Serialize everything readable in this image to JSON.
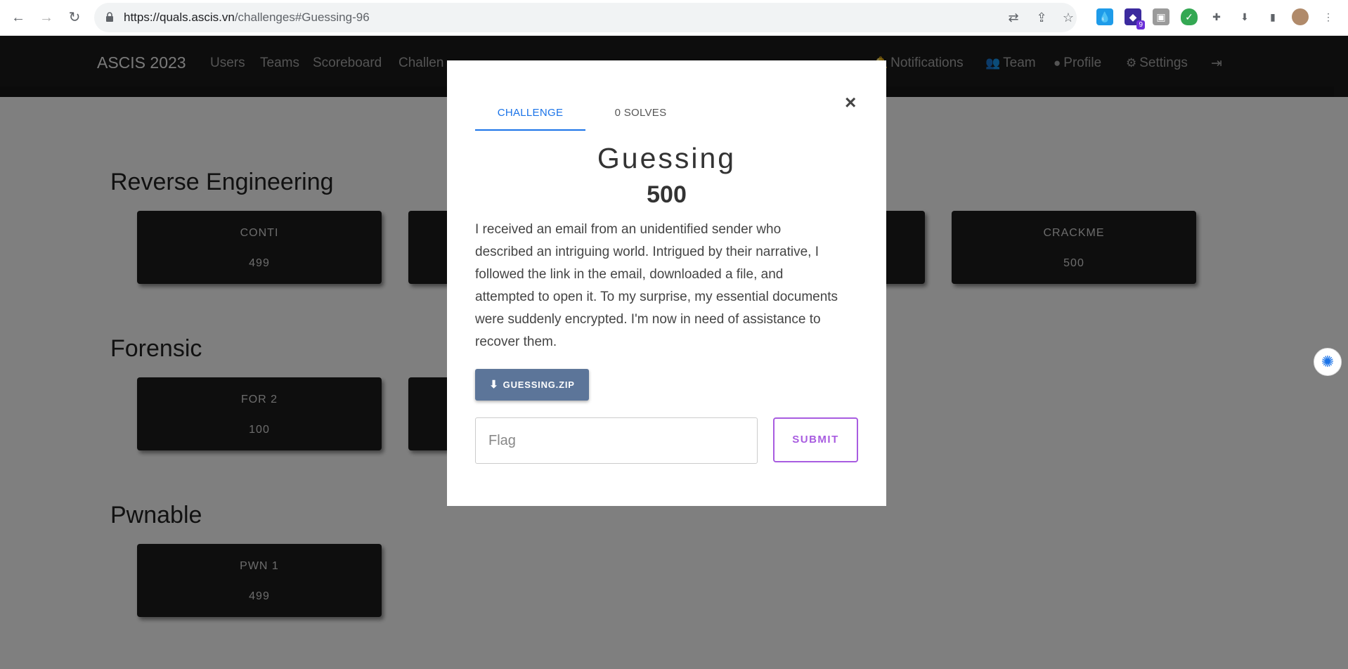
{
  "browser": {
    "url_host": "https://quals.ascis.vn",
    "url_path": "/challenges#Guessing-96",
    "extension_badge": "9"
  },
  "site": {
    "brand": "ASCIS 2023",
    "nav_left": [
      "Users",
      "Teams",
      "Scoreboard",
      "Challen"
    ],
    "nav_right": {
      "notifications": "Notifications",
      "team": "Team",
      "profile": "Profile",
      "settings": "Settings"
    }
  },
  "categories": [
    {
      "title": "Reverse Engineering",
      "cards": [
        {
          "name": "CONTI",
          "value": "499"
        },
        {
          "name": "CRACKME",
          "value": "500"
        }
      ]
    },
    {
      "title": "Forensic",
      "cards": [
        {
          "name": "FOR 2",
          "value": "100"
        }
      ]
    },
    {
      "title": "Pwnable",
      "cards": [
        {
          "name": "PWN 1",
          "value": "499"
        }
      ]
    }
  ],
  "modal": {
    "tabs": [
      "CHALLENGE",
      "0 SOLVES"
    ],
    "close": "×",
    "name": "Guessing",
    "value": "500",
    "description": "I received an email from an unidentified sender who described an intriguing world. Intrigued by their narrative, I followed the link in the email, downloaded a file, and attempted to open it. To my surprise, my essential documents were suddenly encrypted. I'm now in need of assistance to recover them.",
    "download_label": "GUESSING.ZIP",
    "flag_placeholder": "Flag",
    "submit_label": "SUBMIT"
  },
  "colors": {
    "accent_tab": "#1a73e8",
    "submit": "#a85ce0",
    "download_btn": "#5c7599",
    "nav_bg": "#1b1b1b"
  }
}
